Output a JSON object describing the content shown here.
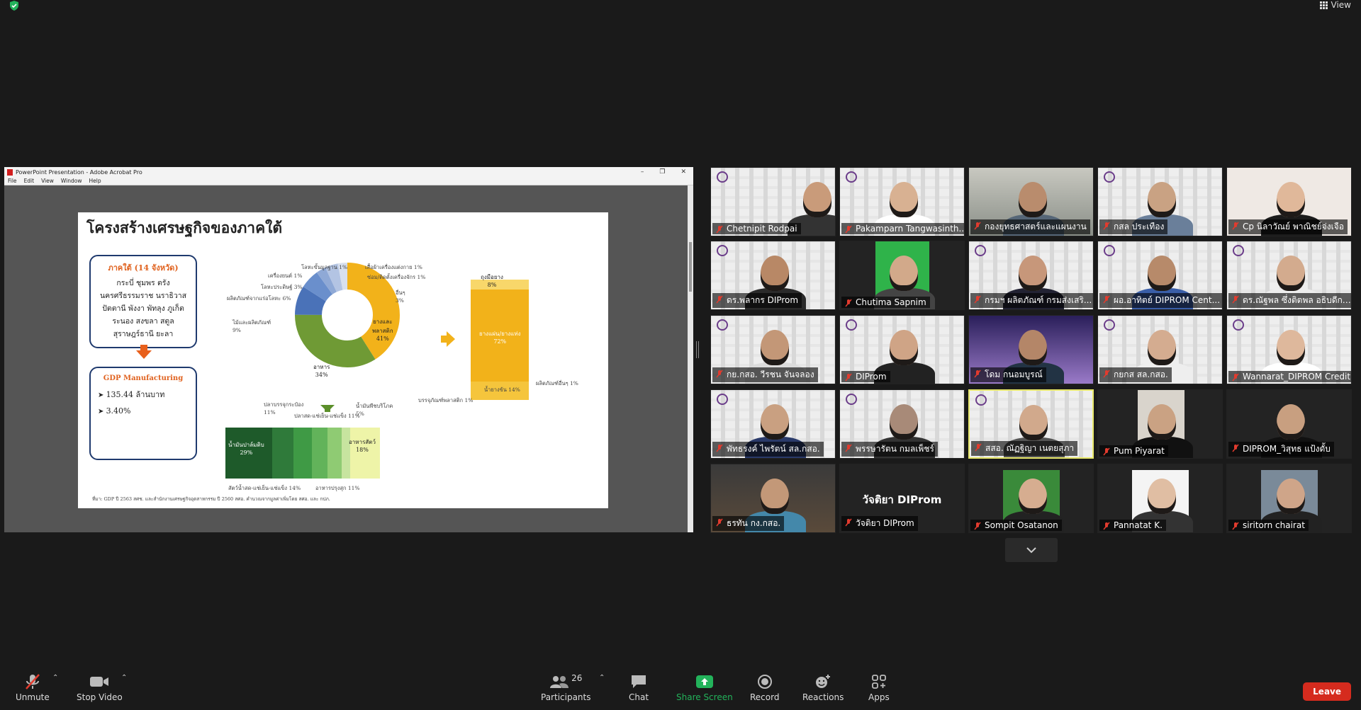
{
  "top": {
    "view_label": "View"
  },
  "shared_window": {
    "title": "PowerPoint Presentation - Adobe Acrobat Pro",
    "menu": [
      "File",
      "Edit",
      "View",
      "Window",
      "Help"
    ]
  },
  "slide": {
    "title": "โครงสร้างเศรษฐกิจของภาคใต้",
    "region_title": "ภาคใต้ (14 จังหวัด)",
    "provinces": [
      "กระบี่ ชุมพร ตรัง",
      "นครศรีธรรมราช นราธิวาส",
      "ปัตตานี พังงา พัทลุง ภูเก็ต",
      "ระนอง สงขลา สตูล",
      "สุราษฎร์ธานี ยะลา"
    ],
    "gdp_title": "GDP Manufacturing",
    "gdp_values": [
      "135.44 ล้านบาท",
      "3.40%"
    ],
    "pie_labels": {
      "rubber": "ยางและ\nพลาสติก\n41%",
      "food": "อาหาร\n34%",
      "other": "อื่นๆ\n3%",
      "wood": "ไม้และผลิตภัณฑ์\n9%",
      "nonmetal": "ผลิตภัณฑ์จากแร่อโลหะ 6%",
      "metal": "โลหะประดิษฐ์ 3%",
      "machinery": "เครื่องยนต์ 1%",
      "basic_metal": "โลหะขั้นมูลฐาน 1%",
      "apparel": "เสื้อผ้าเครื่องแต่งกาย 1%",
      "repair": "ซ่อม/ติดตั้งเครื่องจักร 1%"
    },
    "rubber_bar": {
      "top_label": "ถุงมือยาง\n8%",
      "mid_label": "ยางแผ่น/ยางแท่ง\n72%",
      "bottom_label": "น้ำยางข้น 14%",
      "right_label": "ผลิตภัณฑ์อื่นๆ 1%",
      "left_label": "บรรจุภัณฑ์พลาสติก 1%"
    },
    "food_bar": {
      "palm_oil": "น้ำมันปาล์มดิบ\n29%",
      "fish_canned": "ปลาบรรจุกระป๋อง\n11%",
      "seafood_frozen": "ปลาสด-แช่เย็น-แช่แข็ง 11%",
      "veg_oil": "น้ำมันพืชบริโภค\n5%",
      "animal_feed": "อาหารสัตว์\n18%",
      "meat_frozen": "สัตว์น้ำสด-แช่เย็น-แช่แข็ง 14%",
      "processed": "อาหารปรุงสุก 11%"
    },
    "source": "ที่มา: GDP ปี 2563 สศช. และสำนักงานเศรษฐกิจอุตสาหกรรม ปี 2560 สศอ. คำนวณจากมูลค่าเพิ่มโดย สศอ. และ กปภ."
  },
  "participants": [
    {
      "name": "Chetnipit Rodpai"
    },
    {
      "name": "Pakamparn Tangwasinth..."
    },
    {
      "name": "กองยุทธศาสตร์และแผนงาน"
    },
    {
      "name": "กสล ประเทือง"
    },
    {
      "name": "Cp นิลาวัณย์ พาณิชย์จ่งเจือ"
    },
    {
      "name": "ดร.พลากร DIProm"
    },
    {
      "name": "Chutima Sapnim"
    },
    {
      "name": "กรมฯ ผลิตภัณฑ์ กรมส่งเสริ..."
    },
    {
      "name": "ผอ.อาทิตย์ DIPROM Cent..."
    },
    {
      "name": "ดร.ณัฐพล ซึ่งติตพล อธิบดีกรมส่ง..."
    },
    {
      "name": "กย.กสอ. วีรชน จันจลอง"
    },
    {
      "name": "DIProm"
    },
    {
      "name": "โดม กนอมบูรณ์"
    },
    {
      "name": "กยกส สล.กสอ."
    },
    {
      "name": "Wannarat_DIPROM Credit"
    },
    {
      "name": "พัทธรงค์ ไพรัตน์ สล.กสอ."
    },
    {
      "name": "พรรษารัตน กมลเพ็ชร์"
    },
    {
      "name": "สสอ. ณัฏฐิญา เนตยสุภา"
    },
    {
      "name": "Pum Piyarat"
    },
    {
      "name": "DIPROM_วิสุทธ แป้งดั้บ"
    },
    {
      "name": "ธรทัน กง.กสอ."
    },
    {
      "name": "วัจติยา DIProm",
      "big_label": "วัจติยา DIProm"
    },
    {
      "name": "Sompit Osatanon"
    },
    {
      "name": "Pannatat K."
    },
    {
      "name": "siritorn chairat"
    }
  ],
  "toolbar": {
    "unmute": "Unmute",
    "stop_video": "Stop Video",
    "participants": "Participants",
    "participant_count": "26",
    "chat": "Chat",
    "share_screen": "Share Screen",
    "record": "Record",
    "reactions": "Reactions",
    "apps": "Apps",
    "leave": "Leave"
  },
  "colors": {
    "share_green": "#23b35b",
    "leave_red": "#d52b1e",
    "speaking_border": "#e8e86a"
  }
}
